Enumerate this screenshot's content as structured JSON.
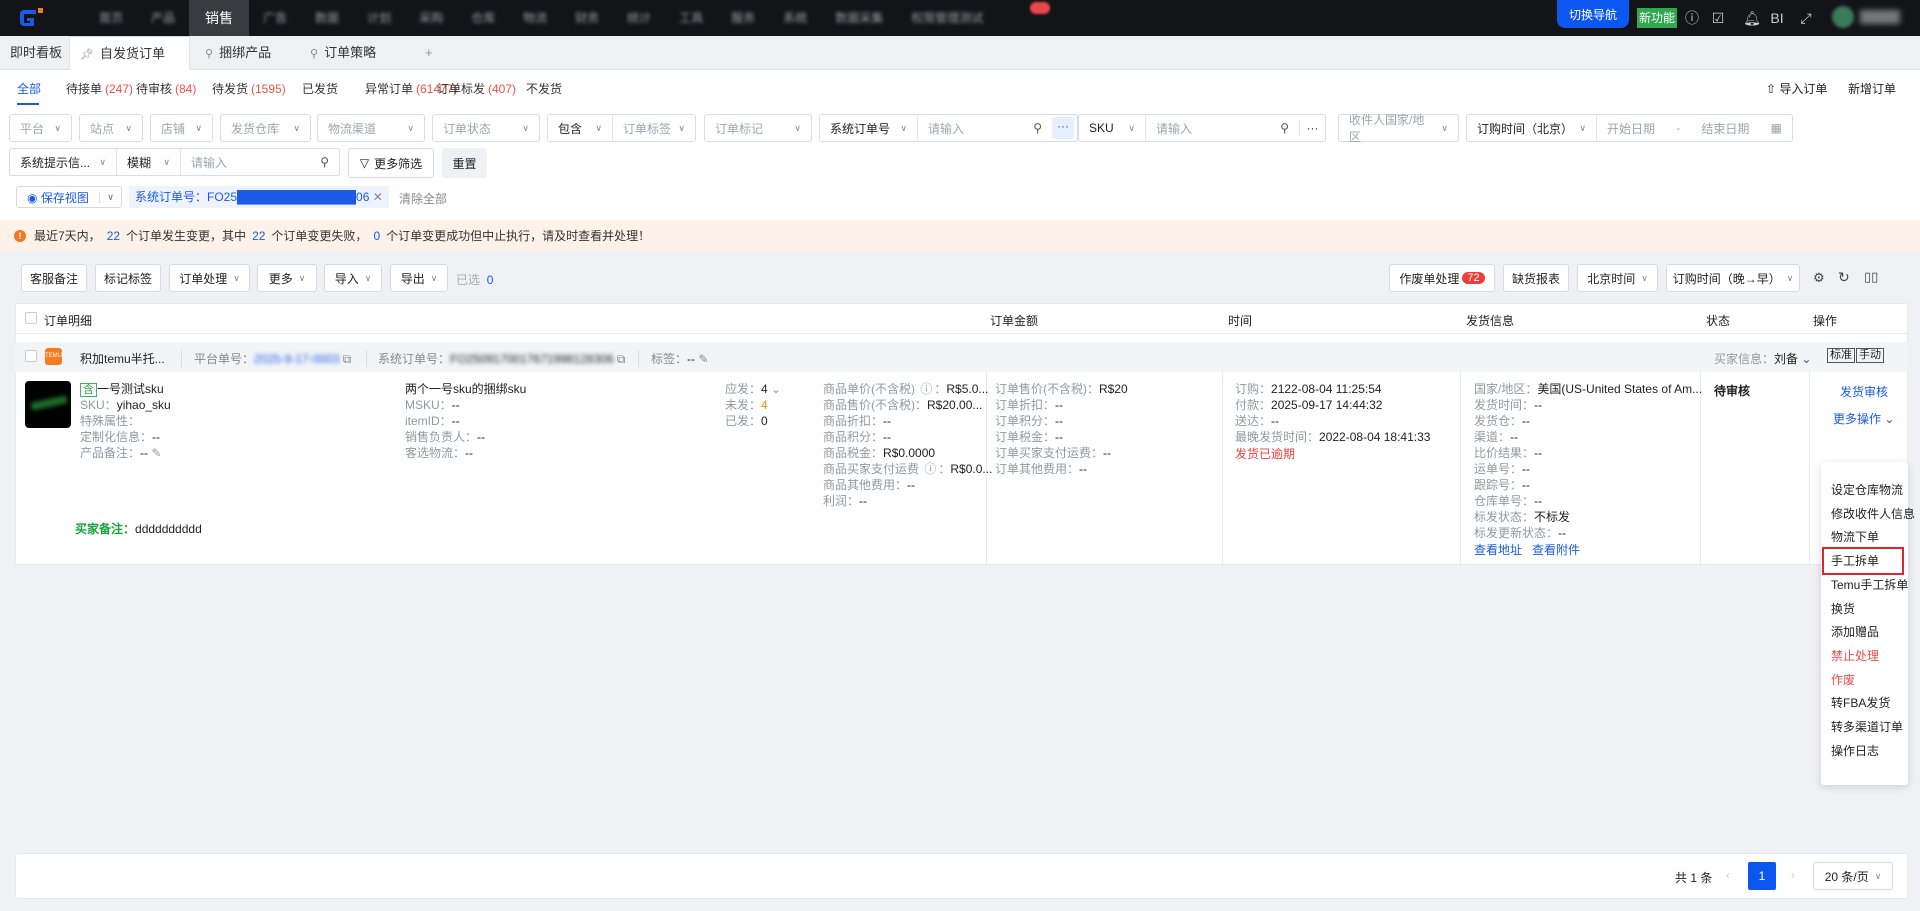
{
  "topbar": {
    "nav": [
      "首页",
      "产品",
      "销售",
      "广告",
      "数据",
      "计划",
      "采购",
      "仓库",
      "物流",
      "财务",
      "统计",
      "工具",
      "服务",
      "系统",
      "数据采集",
      "权限管理测试"
    ],
    "active_nav": "销售",
    "switch_nav": "切换导航",
    "new_feature": "新功能",
    "bi": "BI"
  },
  "page_tabs": {
    "dashboard": "即时看板",
    "items": [
      "自发货订单",
      "捆绑产品",
      "订单策略"
    ],
    "add": "+"
  },
  "status_tabs": [
    {
      "label": "全部",
      "count": ""
    },
    {
      "label": "待接单",
      "count": "(247)"
    },
    {
      "label": "待审核",
      "count": "(84)"
    },
    {
      "label": "待发货",
      "count": "(1595)"
    },
    {
      "label": "已发货",
      "count": ""
    },
    {
      "label": "异常订单",
      "count": "(61477)"
    },
    {
      "label": "订单标发",
      "count": "(407)"
    },
    {
      "label": "不发货",
      "count": ""
    }
  ],
  "actions": {
    "import_order": "导入订单",
    "new_order": "新增订单"
  },
  "filters": {
    "platform": "平台",
    "site": "站点",
    "shop": "店铺",
    "warehouse": "发货仓库",
    "logistics": "物流渠道",
    "order_status": "订单状态",
    "include": "包含",
    "order_tag": "订单标签",
    "order_mark": "订单标记",
    "sys_order_no": "系统订单号",
    "placeholder": "请输入",
    "sku": "SKU",
    "country": "收件人国家/地区",
    "order_time": "订购时间（北京）",
    "start_date": "开始日期",
    "date_sep": "-",
    "end_date": "结束日期",
    "sys_hint": "系统提示信...",
    "fuzzy": "模糊",
    "more_filter": "更多筛选",
    "reset": "重置",
    "save_view": "保存视图",
    "chip": "系统订单号：FO25██████████████06",
    "clear_all": "清除全部"
  },
  "alert": {
    "p1": "最近7天内，",
    "n1": "22",
    "p2": "个订单发生变更，其中",
    "n2": "22",
    "p3": "个订单变更失败，",
    "n3": "0",
    "p4": "个订单变更成功但中止执行，请及时查看并处理！"
  },
  "toolbar": {
    "cs_note": "客服备注",
    "mark_tag": "标记标签",
    "order_process": "订单处理",
    "more": "更多",
    "import": "导入",
    "export": "导出",
    "selected_label": "已选",
    "selected_count": "0",
    "void_process": "作废单处理",
    "void_count": "72",
    "stock_report": "缺货报表",
    "timezone": "北京时间",
    "sort": "订购时间（晚→早）"
  },
  "table": {
    "headers": {
      "detail": "订单明细",
      "amount": "订单金额",
      "time": "时间",
      "ship": "发货信息",
      "status": "状态",
      "ops": "操作"
    }
  },
  "order": {
    "shop": "积加temu半托...",
    "platform_no_label": "平台单号：",
    "platform_no": "2025-9-17-0003",
    "sys_no_label": "系统订单号：",
    "sys_no": "FO2509170017671998128306",
    "tag_label": "标签：",
    "tag": "--",
    "buyer_label": "买家信息：",
    "buyer": "刘备",
    "badge_std": "标准",
    "badge_manual": "手动",
    "product": {
      "incl": "含",
      "name": "一号测试sku",
      "sku_label": "SKU：",
      "sku": "yihao_sku",
      "special_label": "特殊属性：",
      "custom_label": "定制化信息：",
      "custom": "--",
      "note_label": "产品备注：",
      "note": "--"
    },
    "bundle": {
      "name": "两个一号sku的捆绑sku",
      "msku_label": "MSKU：",
      "msku": "--",
      "item_label": "itemID：",
      "item": "--",
      "sales_label": "销售负责人：",
      "sales": "--",
      "logistics_label": "客选物流：",
      "logistics": "--"
    },
    "qty": {
      "due_label": "应发：",
      "due": "4",
      "unsent_label": "未发：",
      "unsent": "4",
      "sent_label": "已发：",
      "sent": "0"
    },
    "price": [
      {
        "l": "商品单价(不含税)",
        "q": true,
        "v": "R$5.0..."
      },
      {
        "l": "商品售价(不含税)",
        "q": false,
        "v": "R$20.00..."
      },
      {
        "l": "商品折扣",
        "q": false,
        "v": "--"
      },
      {
        "l": "商品积分",
        "q": false,
        "v": "--"
      },
      {
        "l": "商品税金",
        "q": false,
        "v": "R$0.0000"
      },
      {
        "l": "商品买家支付运费",
        "q": true,
        "v": "R$0.0..."
      },
      {
        "l": "商品其他费用",
        "q": false,
        "v": "--"
      },
      {
        "l": "利润",
        "q": false,
        "v": "--"
      }
    ],
    "amount": [
      {
        "l": "订单售价(不含税)",
        "v": "R$20"
      },
      {
        "l": "订单折扣",
        "v": "--"
      },
      {
        "l": "订单积分",
        "v": "--"
      },
      {
        "l": "订单税金",
        "v": "--"
      },
      {
        "l": "订单买家支付运费",
        "v": "--"
      },
      {
        "l": "订单其他费用",
        "v": "--"
      }
    ],
    "times": [
      {
        "l": "订购",
        "v": "2122-08-04 11:25:54"
      },
      {
        "l": "付款",
        "v": "2025-09-17 14:44:32"
      },
      {
        "l": "送达",
        "v": "--"
      },
      {
        "l": "最晚发货时间",
        "v": "2022-08-04 18:41:33"
      }
    ],
    "overdue": "发货已逾期",
    "ship": [
      {
        "l": "国家/地区",
        "v": "美国(US-United States of Am..."
      },
      {
        "l": "发货时间",
        "v": "--"
      },
      {
        "l": "发货仓",
        "v": "--"
      },
      {
        "l": "渠道",
        "v": "--"
      },
      {
        "l": "比价结果",
        "v": "--"
      },
      {
        "l": "运单号",
        "v": "--"
      },
      {
        "l": "跟踪号",
        "v": "--"
      },
      {
        "l": "仓库单号",
        "v": "--"
      },
      {
        "l": "标发状态",
        "v": "不标发"
      },
      {
        "l": "标发更新状态",
        "v": "--"
      }
    ],
    "view_address": "查看地址",
    "view_attach": "查看附件",
    "status": "待审核",
    "ship_review": "发货审核",
    "more_ops": "更多操作",
    "buyer_note_label": "买家备注：",
    "buyer_note": "dddddddddd"
  },
  "menu": [
    "设定仓库物流",
    "修改收件人信息",
    "物流下单",
    "手工拆单",
    "Temu手工拆单",
    "换货",
    "添加赠品",
    "禁止处理",
    "作废",
    "转FBA发货",
    "转多渠道订单",
    "操作日志"
  ],
  "pagination": {
    "total": "共 1 条",
    "page": "1",
    "page_size": "20 条/页"
  },
  "colors": {
    "accent": "#1a5ae8",
    "danger": "#ef4a4a",
    "warning": "#f07a2a"
  }
}
